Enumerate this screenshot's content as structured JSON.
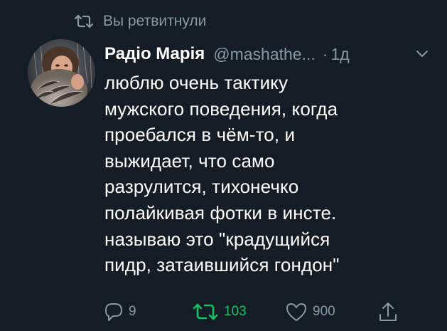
{
  "colors": {
    "background": "#141d26",
    "primary_text": "#ffffff",
    "secondary_text": "#8899a6",
    "retweet_active": "#17bf63"
  },
  "retweet_context": {
    "icon": "retweet-icon",
    "text": "Вы ретвитнули"
  },
  "tweet": {
    "avatar_icon": "avatar",
    "display_name": "Радіо Марія",
    "handle": "@mashathe...",
    "separator": "·",
    "time": "1д",
    "menu_icon": "chevron-down-icon",
    "text": "люблю очень тактику\nмужского поведения, когда\nпроебался в чём-то, и\nвыжидает, что само\nразрулится, тихонечко\nполайкивая фотки в инсте.\nназываю это \"крадущийся\nпидр, затаившийся гондон\""
  },
  "actions": {
    "reply": {
      "icon": "reply-icon",
      "count": "9"
    },
    "retweet": {
      "icon": "retweet-icon",
      "count": "103",
      "active": true
    },
    "like": {
      "icon": "heart-icon",
      "count": "900"
    },
    "share": {
      "icon": "share-icon",
      "count": ""
    }
  }
}
